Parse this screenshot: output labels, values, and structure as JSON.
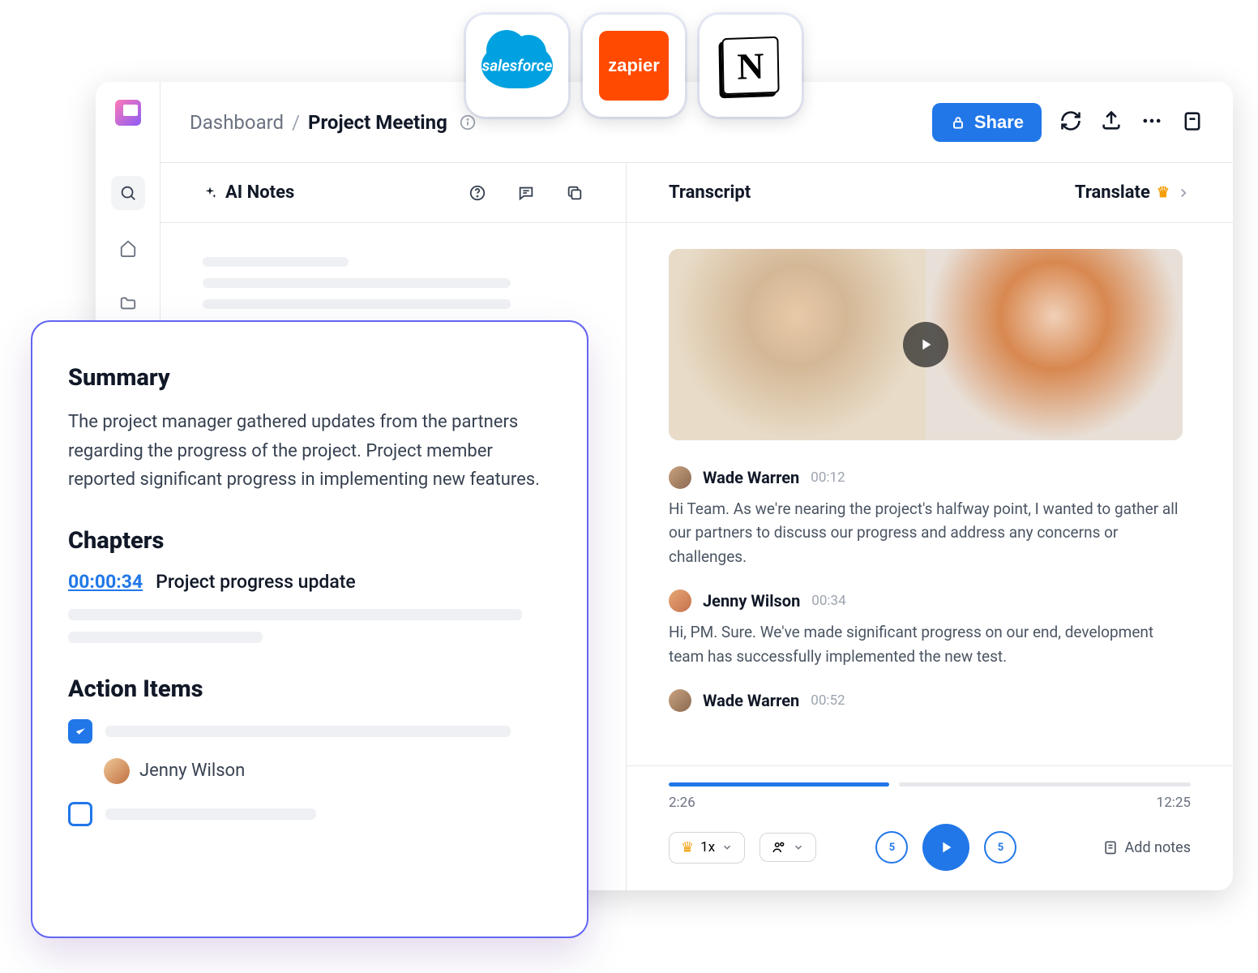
{
  "integrations": {
    "salesforce": "salesforce",
    "zapier": "zapier",
    "notion": "N"
  },
  "breadcrumb": {
    "dashboard": "Dashboard",
    "sep": "/",
    "title": "Project Meeting"
  },
  "header": {
    "share": "Share"
  },
  "left_panel": {
    "title": "AI Notes"
  },
  "right_panel": {
    "title": "Transcript",
    "translate": "Translate"
  },
  "transcript": [
    {
      "speaker": "Wade Warren",
      "time": "00:12",
      "text": "Hi Team. As we're nearing the project's halfway point, I wanted to gather all our partners to discuss our progress and address any concerns or challenges."
    },
    {
      "speaker": "Jenny Wilson",
      "time": "00:34",
      "text": "Hi, PM. Sure. We've made significant progress on our end, development team has successfully implemented the new test."
    },
    {
      "speaker": "Wade Warren",
      "time": "00:52",
      "text": ""
    }
  ],
  "player": {
    "current": "2:26",
    "total": "12:25",
    "speed": "1x",
    "skip_back": "5",
    "skip_fwd": "5",
    "add_notes": "Add notes"
  },
  "summary": {
    "h_summary": "Summary",
    "body": "The project manager gathered updates from the partners regarding the progress of the project. Project member reported significant progress in implementing new features.",
    "h_chapters": "Chapters",
    "chapter_ts": "00:00:34",
    "chapter_title": "Project progress update",
    "h_actions": "Action Items",
    "assignee": "Jenny Wilson"
  }
}
